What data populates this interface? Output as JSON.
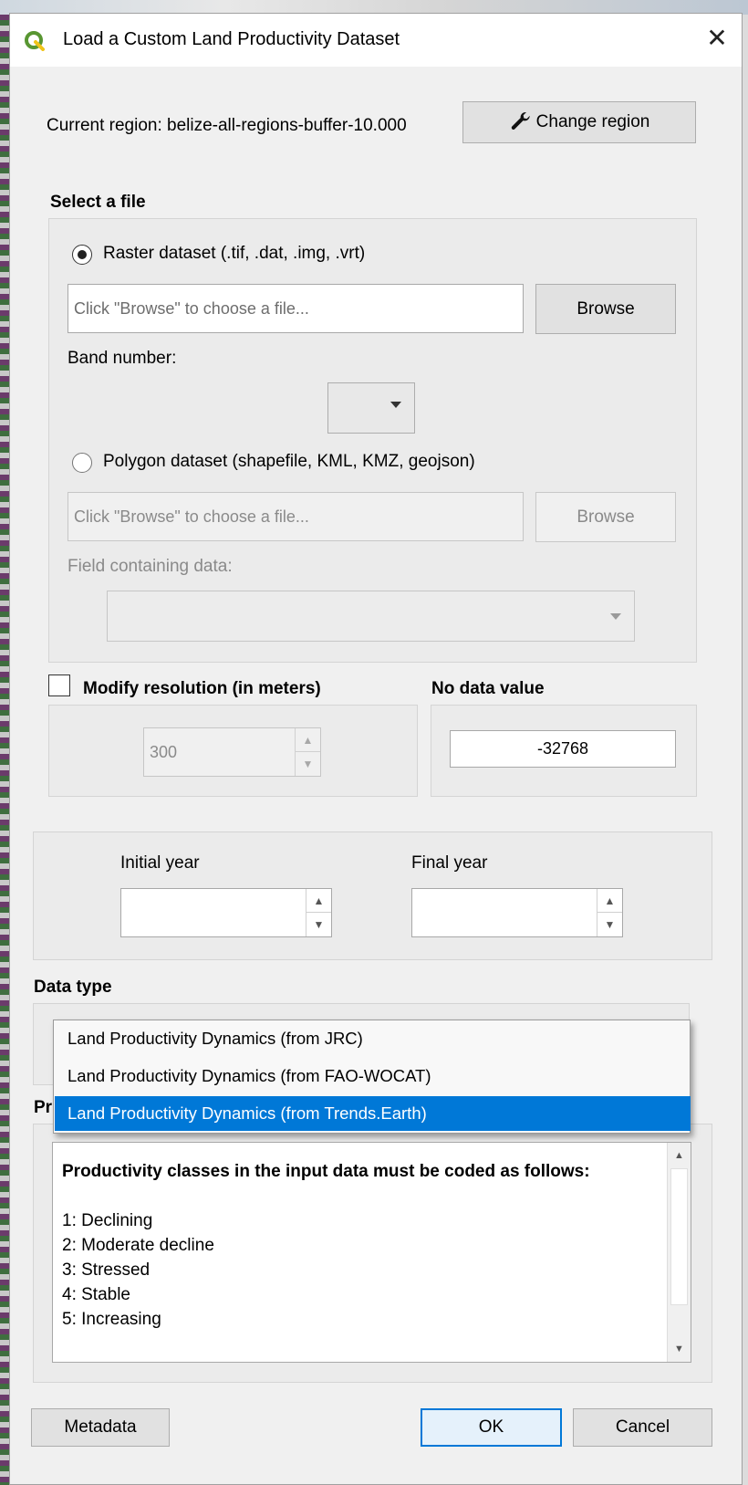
{
  "dialog": {
    "title": "Load a Custom Land Productivity Dataset",
    "close_glyph": "✕"
  },
  "region": {
    "current_label": "Current region: belize-all-regions-buffer-10.000",
    "change_button": "Change region"
  },
  "select_file": {
    "heading": "Select a file",
    "raster_option": "Raster dataset (.tif, .dat, .img, .vrt)",
    "raster_placeholder": "Click \"Browse\" to choose a file...",
    "browse_label": "Browse",
    "band_number_label": "Band number:",
    "polygon_option": "Polygon dataset (shapefile, KML, KMZ, geojson)",
    "polygon_placeholder": "Click \"Browse\" to choose a file...",
    "polygon_browse_label": "Browse",
    "field_label": "Field containing data:"
  },
  "resolution": {
    "checkbox_label": "Modify resolution (in meters)",
    "value": "300"
  },
  "nodata": {
    "label": "No data value",
    "value": "-32768"
  },
  "years": {
    "initial_label": "Initial year",
    "final_label": "Final year"
  },
  "data_type": {
    "label": "Data type",
    "options": [
      "Land Productivity Dynamics (from JRC)",
      "Land Productivity Dynamics (from FAO-WOCAT)",
      "Land Productivity Dynamics (from Trends.Earth)"
    ],
    "selected_index": 2
  },
  "productivity": {
    "label_fragment": "Pr",
    "heading": "Productivity classes in the input data must be coded as follows:",
    "classes": [
      "1: Declining",
      "2: Moderate decline",
      "3: Stressed",
      "4: Stable",
      "5: Increasing"
    ]
  },
  "footer": {
    "metadata_label": "Metadata",
    "ok_label": "OK",
    "cancel_label": "Cancel"
  },
  "colors": {
    "accent": "#0078d7",
    "qgis_green": "#589632",
    "qgis_yellow": "#f0c419"
  },
  "icons": [
    "qgis-logo-icon",
    "close-icon",
    "wrench-icon",
    "chevron-down-icon",
    "spin-up-icon",
    "spin-down-icon",
    "scroll-up-icon",
    "scroll-down-icon"
  ]
}
